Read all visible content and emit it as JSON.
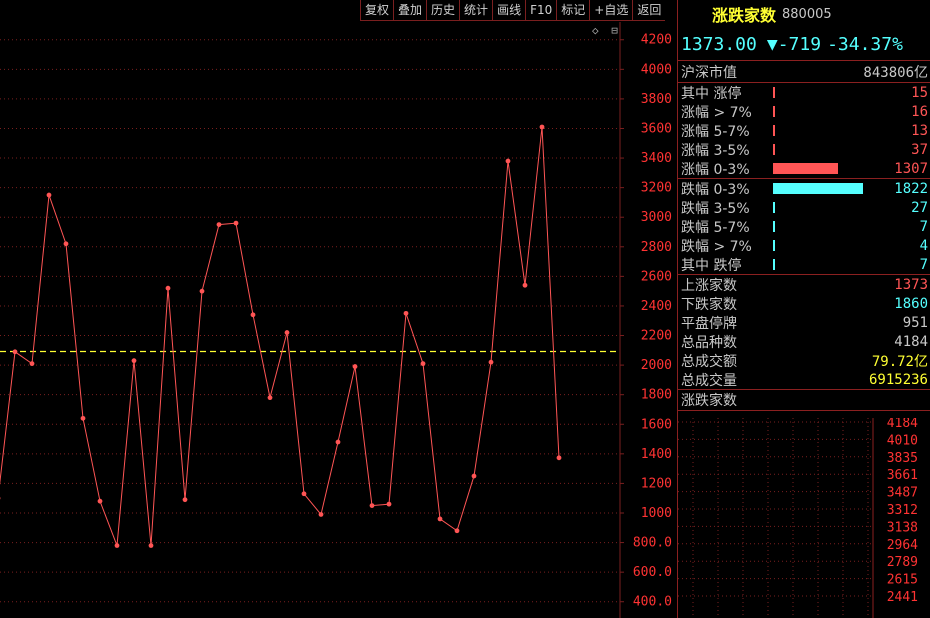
{
  "toolbar": [
    "复权",
    "叠加",
    "历史",
    "统计",
    "画线",
    "F10",
    "标记",
    "+自选",
    "返回"
  ],
  "corner_icons": [
    "◇",
    "⊟"
  ],
  "header": {
    "title": "涨跌家数",
    "code": "880005"
  },
  "quote": {
    "price": "1373.00",
    "arrow": "▼",
    "change": "-719",
    "pct": "-34.37%"
  },
  "market_cap": {
    "label": "沪深市值",
    "value": "843806亿"
  },
  "up_rows": [
    {
      "label": "其中 涨停",
      "value": "15",
      "ratio": 0.0,
      "color": "#ff5555"
    },
    {
      "label": "涨幅 > 7%",
      "value": "16",
      "ratio": 0.0,
      "color": "#ff5555"
    },
    {
      "label": "涨幅 5-7%",
      "value": "13",
      "ratio": 0.0,
      "color": "#ff5555"
    },
    {
      "label": "涨幅 3-5%",
      "value": "37",
      "ratio": 0.0,
      "color": "#ff5555"
    },
    {
      "label": "涨幅 0-3%",
      "value": "1307",
      "ratio": 0.72,
      "color": "#ff5555"
    }
  ],
  "down_rows": [
    {
      "label": "跌幅 0-3%",
      "value": "1822",
      "ratio": 1.0,
      "color": "#55ffff"
    },
    {
      "label": "跌幅 3-5%",
      "value": "27",
      "ratio": 0.0,
      "color": "#55ffff"
    },
    {
      "label": "跌幅 5-7%",
      "value": "7",
      "ratio": 0.0,
      "color": "#55ffff"
    },
    {
      "label": "跌幅 > 7%",
      "value": "4",
      "ratio": 0.0,
      "color": "#55ffff"
    },
    {
      "label": "其中 跌停",
      "value": "7",
      "ratio": 0.0,
      "color": "#55ffff"
    }
  ],
  "stats": [
    {
      "label": "上涨家数",
      "value": "1373",
      "color": "#ff5555"
    },
    {
      "label": "下跌家数",
      "value": "1860",
      "color": "#55ffff"
    },
    {
      "label": "平盘停牌",
      "value": "951",
      "color": "#c8c8c8"
    },
    {
      "label": "总品种数",
      "value": "4184",
      "color": "#c8c8c8"
    },
    {
      "label": "总成交额",
      "value": "79.72亿",
      "color": "#ffff33"
    },
    {
      "label": "总成交量",
      "value": "6915236",
      "color": "#ffff33"
    }
  ],
  "mini_chart": {
    "title": "涨跌家数",
    "ticks": [
      "4184",
      "4010",
      "3835",
      "3661",
      "3487",
      "3312",
      "3138",
      "2964",
      "2789",
      "2615",
      "2441"
    ]
  },
  "chart_data": {
    "type": "line",
    "y_ticks": [
      4200,
      4000,
      3800,
      3600,
      3400,
      3200,
      3000,
      2800,
      2600,
      2400,
      2200,
      2000,
      1800,
      1600,
      1400,
      1200,
      1000,
      800,
      600,
      400
    ],
    "y_tick_labels": [
      "4200",
      "4000",
      "3800",
      "3600",
      "3400",
      "3200",
      "3000",
      "2800",
      "2600",
      "2400",
      "2200",
      "2000",
      "1800",
      "1600",
      "1400",
      "1200",
      "1000",
      "800.0",
      "600.0",
      "400.0"
    ],
    "ylim": [
      290,
      4320
    ],
    "reference": 2092,
    "values": [
      1100,
      2090,
      2010,
      3150,
      2820,
      1640,
      1080,
      780,
      2030,
      780,
      2520,
      1090,
      2500,
      2950,
      2960,
      2340,
      1780,
      2220,
      1130,
      990,
      1480,
      1990,
      1050,
      1060,
      2350,
      2010,
      960,
      880,
      1250,
      2020,
      3380,
      2540,
      3610,
      1373
    ],
    "colors": {
      "line": "#ff5555",
      "grid": "#7a1f1f",
      "axis_text": "#ff3333",
      "reference": "#ffff33"
    }
  }
}
